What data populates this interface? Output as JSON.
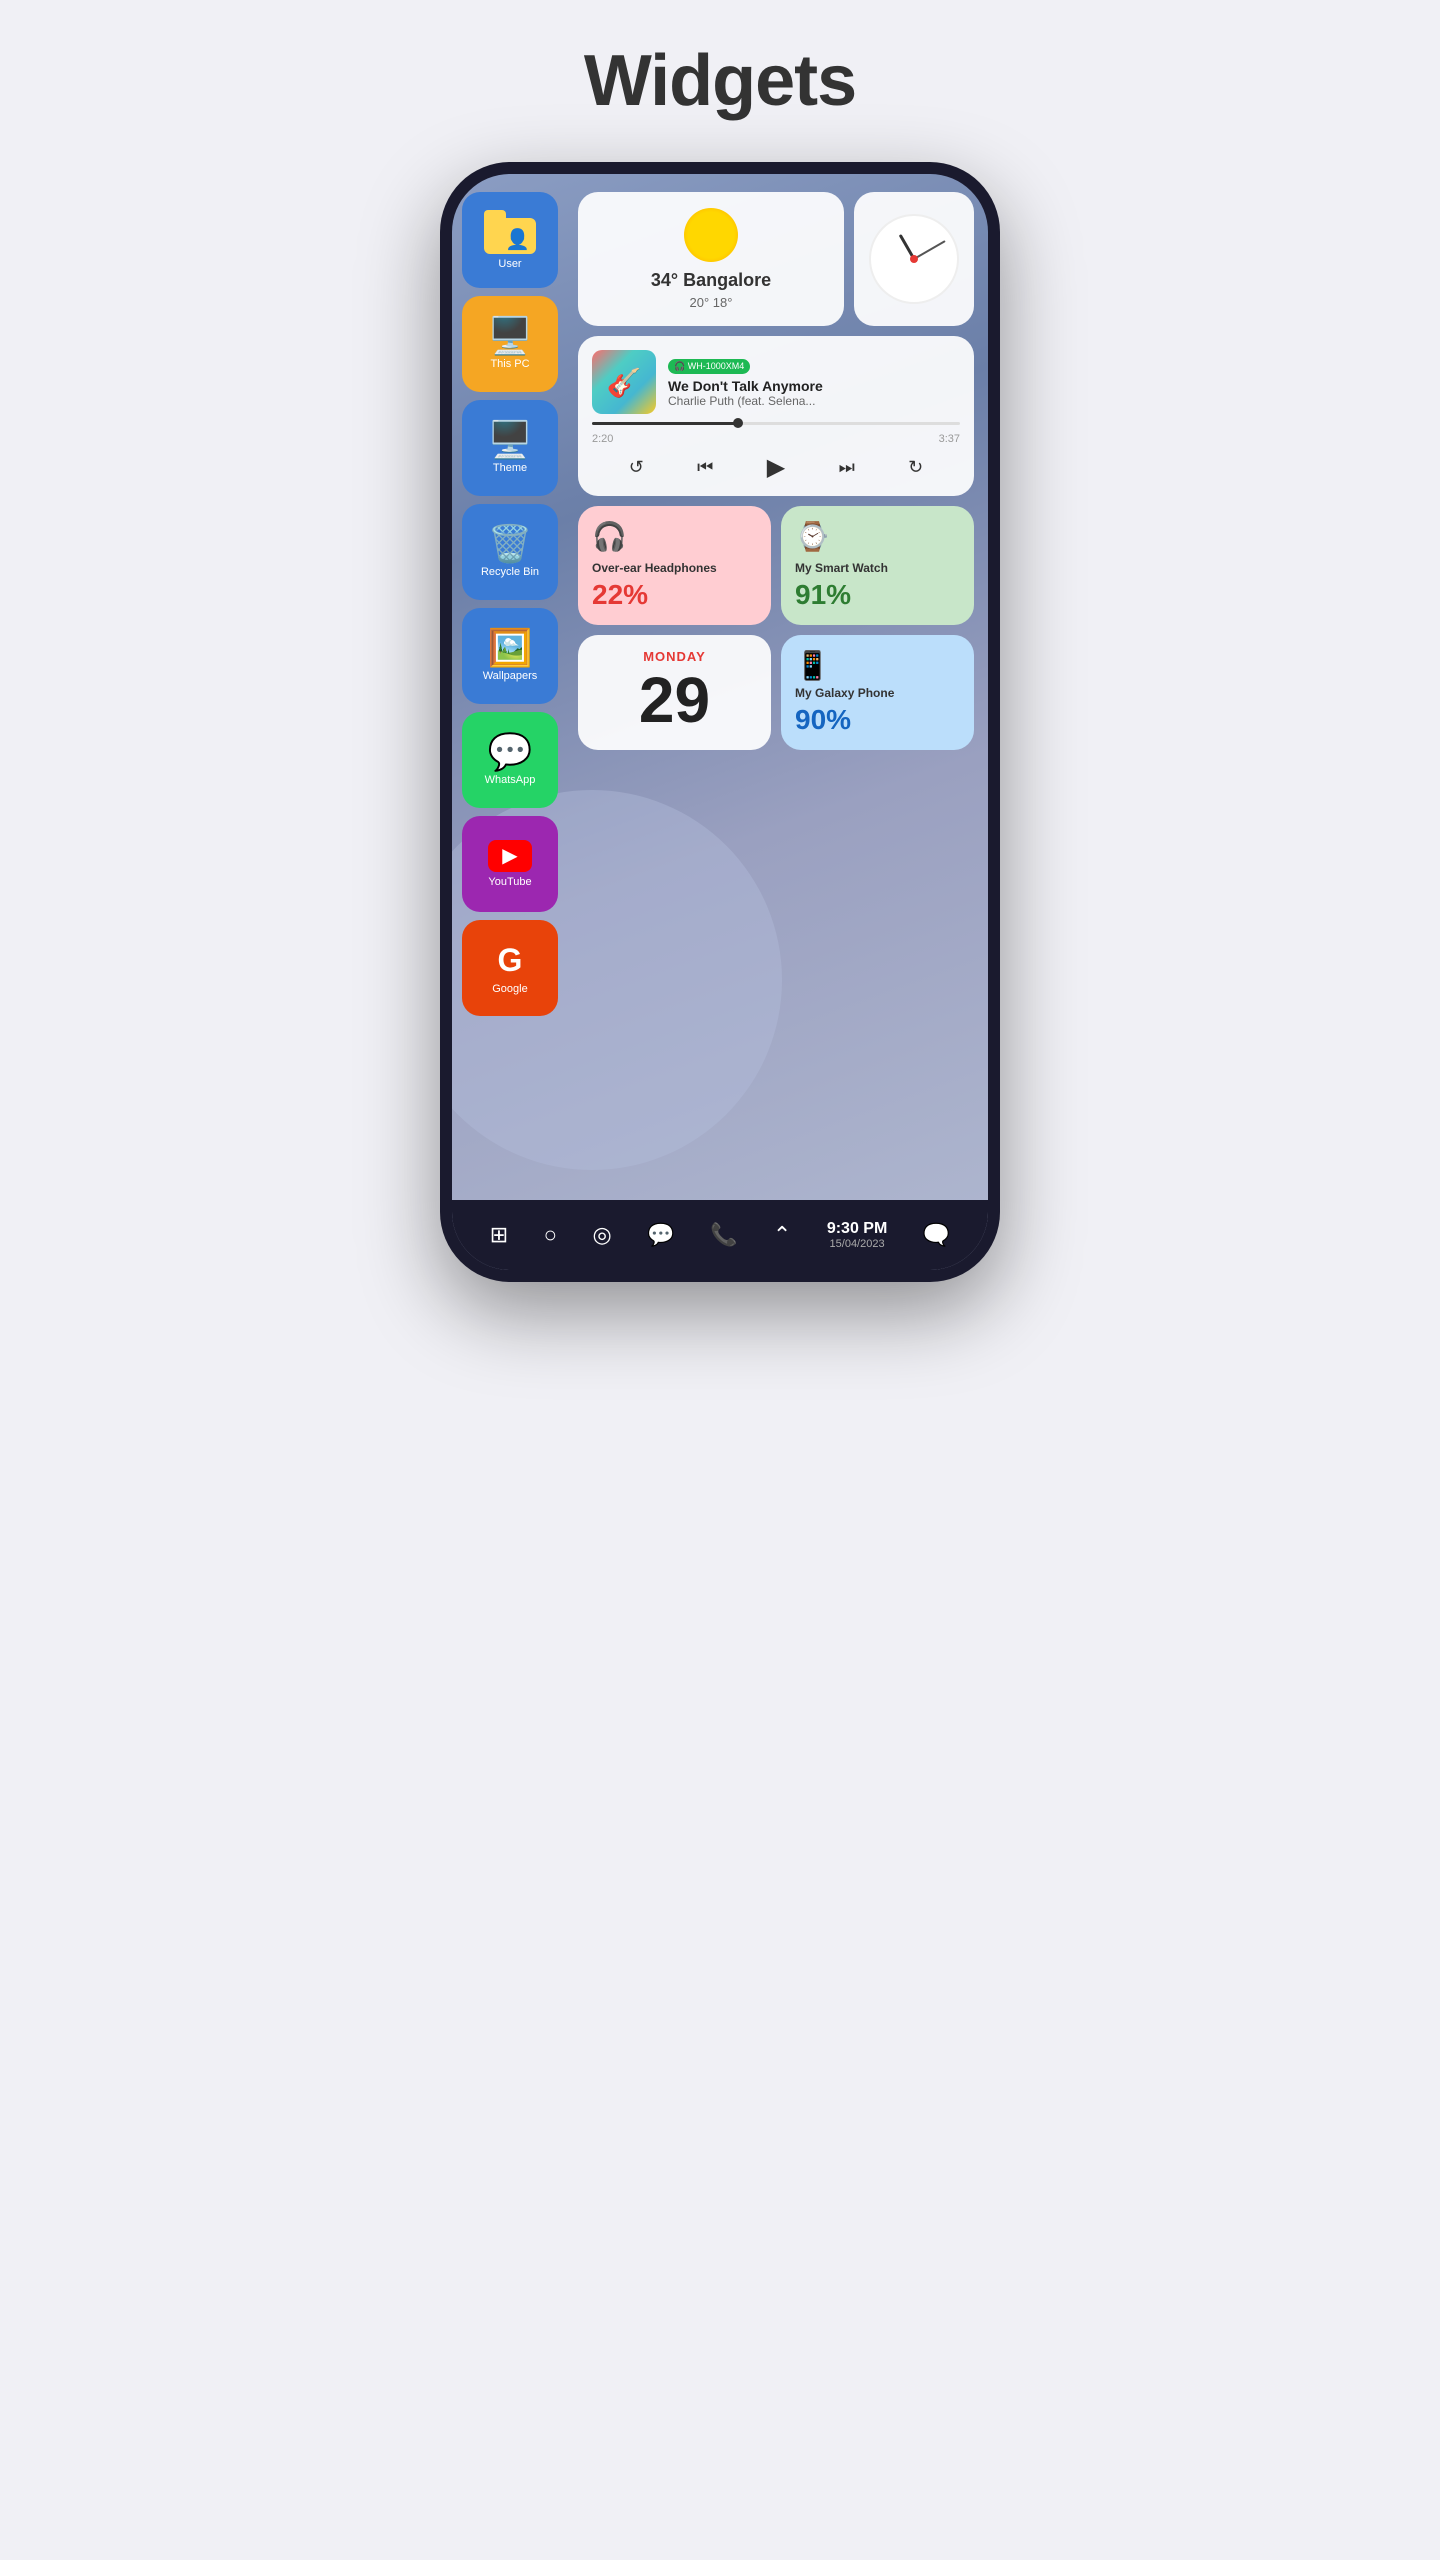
{
  "page": {
    "title": "Widgets"
  },
  "sidebar": {
    "apps": [
      {
        "id": "user",
        "label": "User",
        "color": "#3a7bd5",
        "icon": "📁",
        "class": "app-user"
      },
      {
        "id": "thispc",
        "label": "This PC",
        "color": "#f5a623",
        "icon": "🖥️",
        "class": "app-thispc"
      },
      {
        "id": "theme",
        "label": "Theme",
        "color": "#3a7bd5",
        "icon": "🖥️",
        "class": "app-theme"
      },
      {
        "id": "recycle",
        "label": "Recycle Bin",
        "color": "#3a7bd5",
        "icon": "🗑️",
        "class": "app-recycle"
      },
      {
        "id": "wallpapers",
        "label": "Wallpapers",
        "color": "#3a7bd5",
        "icon": "🖼️",
        "class": "app-wallpapers"
      },
      {
        "id": "whatsapp",
        "label": "WhatsApp",
        "color": "#25d366",
        "icon": "💬",
        "class": "app-whatsapp"
      },
      {
        "id": "youtube",
        "label": "YouTube",
        "color": "#9c27b0",
        "icon": "▶️",
        "class": "app-youtube"
      },
      {
        "id": "google",
        "label": "Google",
        "color": "#e8430a",
        "icon": "G",
        "class": "app-google"
      }
    ]
  },
  "widgets": {
    "weather": {
      "temp": "34° Bangalore",
      "minmax": "20° 18°"
    },
    "music": {
      "device_badge": "🎧 WH-1000XM4",
      "title": "We Don't Talk Anymore",
      "artist": "Charlie Puth (feat. Selena...",
      "time_current": "2:20",
      "time_total": "3:37",
      "progress_percent": 40
    },
    "headphones": {
      "icon": "🎧",
      "name": "Over-ear Headphones",
      "battery": "22%"
    },
    "smartwatch": {
      "icon": "⌚",
      "name": "My Smart Watch",
      "battery": "91%"
    },
    "calendar": {
      "day_label": "MONDAY",
      "day_number": "29"
    },
    "galaxy_phone": {
      "icon": "📱",
      "name": "My Galaxy Phone",
      "battery": "90%"
    }
  },
  "bottom_nav": {
    "time": "9:30 PM",
    "date": "15/04/2023",
    "icons": [
      "⊞",
      "○",
      "◎",
      "💬",
      "📞",
      "⌃",
      "🗨️"
    ]
  }
}
